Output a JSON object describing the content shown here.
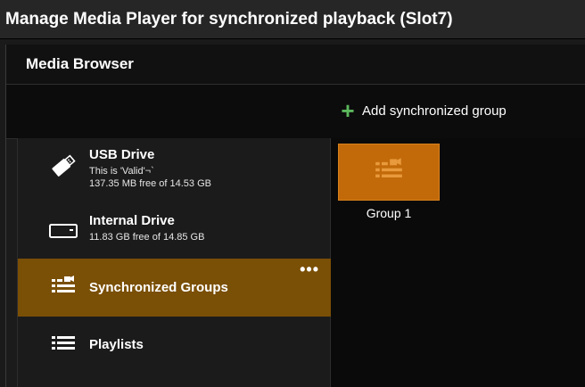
{
  "window": {
    "title": "Manage Media Player for synchronized playback (Slot7)"
  },
  "browser": {
    "title": "Media Browser",
    "add_group_label": "Add synchronized group"
  },
  "sidebar": {
    "items": [
      {
        "name": "USB Drive",
        "line1": "This is 'Valid'¬`",
        "line2": "137.35 MB free of 14.53 GB",
        "icon": "usb-drive-icon"
      },
      {
        "name": "Internal Drive",
        "line1": "11.83 GB free of 14.85 GB",
        "icon": "internal-drive-icon"
      },
      {
        "name": "Synchronized Groups",
        "more": "•••",
        "icon": "synchronized-groups-icon",
        "selected": true
      },
      {
        "name": "Playlists",
        "icon": "playlist-icon"
      }
    ]
  },
  "content": {
    "groups": [
      {
        "label": "Group 1",
        "icon": "synchronized-groups-icon"
      }
    ]
  },
  "colors": {
    "accent_green": "#5cb85c",
    "selected_item": "#7a4f06",
    "group_tile": "#c26a0a"
  }
}
